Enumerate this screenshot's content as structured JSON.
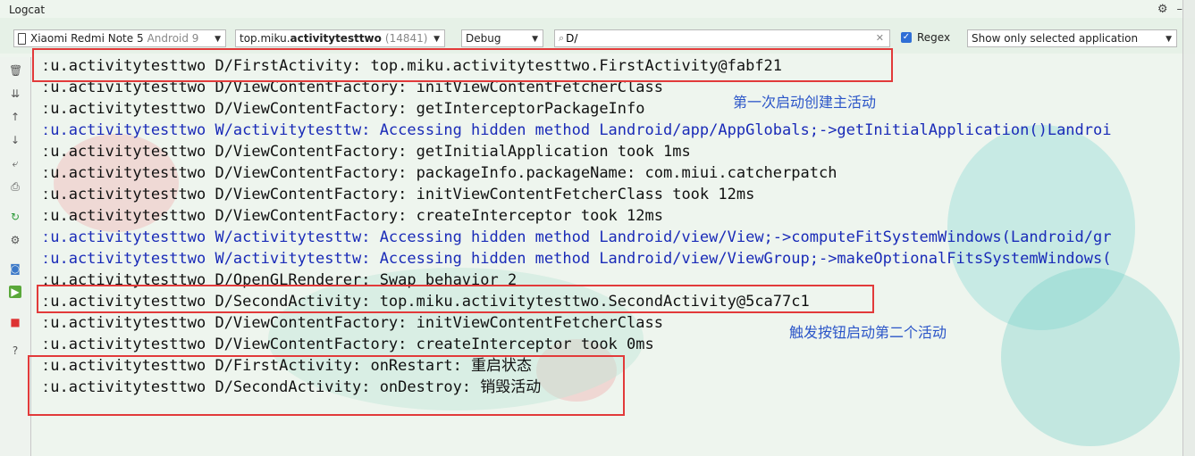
{
  "window": {
    "title": "Logcat"
  },
  "toolbar": {
    "device": {
      "name": "Xiaomi Redmi Note 5",
      "os": "Android 9"
    },
    "process": {
      "prefix": "top.miku.",
      "bold": "activitytesttwo",
      "pid": "(14841)"
    },
    "level": "Debug",
    "search": {
      "value": "D/",
      "placeholder": ""
    },
    "regex_label": "Regex",
    "regex_checked": true,
    "filter": "Show only selected application"
  },
  "icons": {
    "titlebar": [
      "gear-icon",
      "minimize-icon"
    ],
    "gutter": [
      "trash-icon",
      "scroll-to-end-icon",
      "up-arrow-icon",
      "down-arrow-icon",
      "soft-wrap-icon",
      "print-icon",
      "restart-icon",
      "settings-icon",
      "screenshot-icon",
      "video-icon",
      "stop-icon",
      "help-icon"
    ]
  },
  "log": {
    "lines": [
      {
        "level": "D",
        "text": "ːu.activitytesttwo D/FirstActivity: top.miku.activitytesttwo.FirstActivity@fabf21"
      },
      {
        "level": "D",
        "text": "ːu.activitytesttwo D/ViewContentFactory: initViewContentFetcherClass"
      },
      {
        "level": "D",
        "text": "ːu.activitytesttwo D/ViewContentFactory: getInterceptorPackageInfo"
      },
      {
        "level": "W",
        "text": "ːu.activitytesttwo W/activitytesttw: Accessing hidden method Landroid/app/AppGlobals;->getInitialApplication()Landroi"
      },
      {
        "level": "D",
        "text": "ːu.activitytesttwo D/ViewContentFactory: getInitialApplication took 1ms"
      },
      {
        "level": "D",
        "text": "ːu.activitytesttwo D/ViewContentFactory: packageInfo.packageName: com.miui.catcherpatch"
      },
      {
        "level": "D",
        "text": "ːu.activitytesttwo D/ViewContentFactory: initViewContentFetcherClass took 12ms"
      },
      {
        "level": "D",
        "text": "ːu.activitytesttwo D/ViewContentFactory: createInterceptor took 12ms"
      },
      {
        "level": "W",
        "text": "ːu.activitytesttwo W/activitytesttw: Accessing hidden method Landroid/view/View;->computeFitSystemWindows(Landroid/gr"
      },
      {
        "level": "W",
        "text": "ːu.activitytesttwo W/activitytesttw: Accessing hidden method Landroid/view/ViewGroup;->makeOptionalFitsSystemWindows("
      },
      {
        "level": "D",
        "text": "ːu.activitytesttwo D/OpenGLRenderer: Swap behavior 2"
      },
      {
        "level": "D",
        "text": "ːu.activitytesttwo D/SecondActivity: top.miku.activitytesttwo.SecondActivity@5ca77c1"
      },
      {
        "level": "D",
        "text": "ːu.activitytesttwo D/ViewContentFactory: initViewContentFetcherClass"
      },
      {
        "level": "D",
        "text": "ːu.activitytesttwo D/ViewContentFactory: createInterceptor took 0ms"
      },
      {
        "level": "D",
        "text": "ːu.activitytesttwo D/FirstActivity: onRestart: 重启状态"
      },
      {
        "level": "D",
        "text": "ːu.activitytesttwo D/SecondActivity: onDestroy: 销毁活动"
      }
    ]
  },
  "annotations": {
    "note1": "第一次启动创建主活动",
    "note2": "触发按钮启动第二个活动",
    "box_color": "#e23a3a",
    "note_color": "#2b55c8"
  },
  "colors": {
    "debug_text": "#111111",
    "warn_text": "#1a2bb8"
  }
}
